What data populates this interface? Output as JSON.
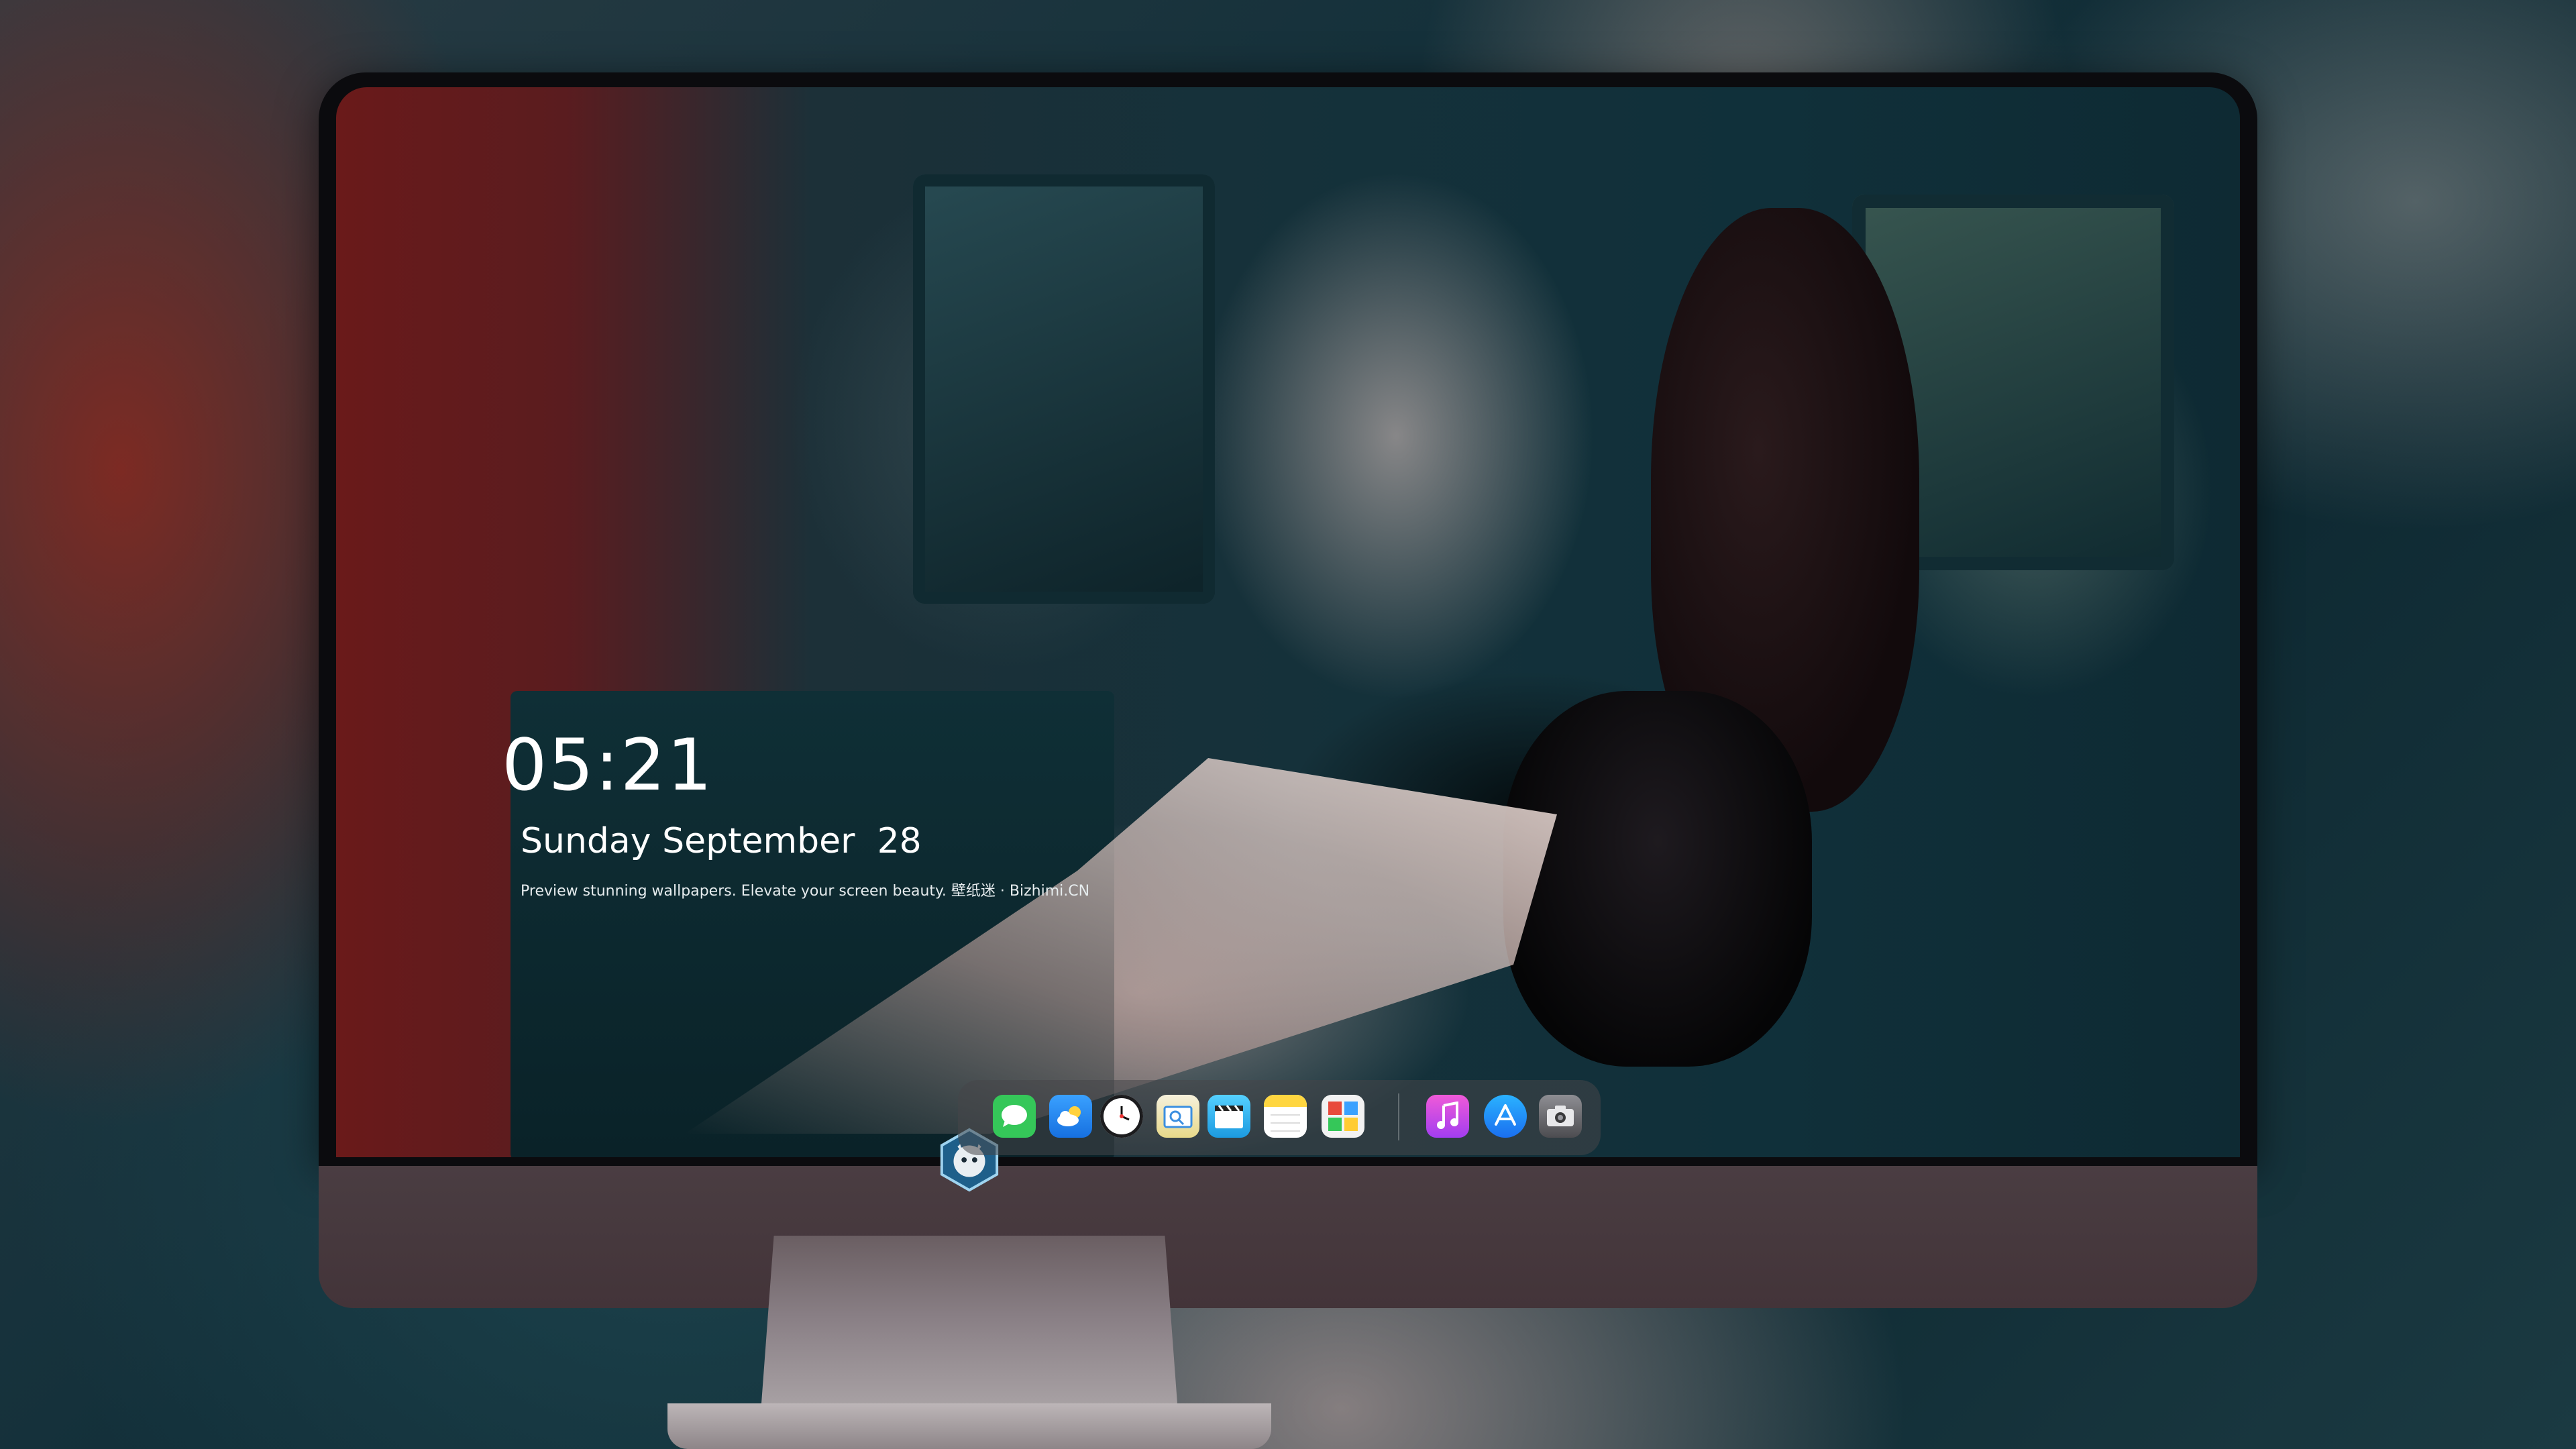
{
  "lock_screen": {
    "time": "05:21",
    "date": "Sunday September  28",
    "tagline": "Preview stunning wallpapers. Elevate your screen beauty. 壁纸迷 · Bizhimi.CN"
  },
  "dock": {
    "apps": [
      {
        "name": "Messages",
        "icon": "messages-icon",
        "color": "#35c759"
      },
      {
        "name": "Weather",
        "icon": "weather-icon",
        "color": "#1e8ef5"
      },
      {
        "name": "Clock",
        "icon": "clock-icon",
        "color": "#1c1c1e"
      },
      {
        "name": "Preview",
        "icon": "preview-icon",
        "color": "#f5c542"
      },
      {
        "name": "Clips",
        "icon": "clips-icon",
        "color": "#2fb6f0"
      },
      {
        "name": "Notes",
        "icon": "notes-icon",
        "color": "#ffd640"
      },
      {
        "name": "Photo Booth",
        "icon": "photo-booth-icon",
        "color": "#d63a3a"
      },
      {
        "name": "iTunes",
        "icon": "music-icon",
        "color": "#c64be8"
      },
      {
        "name": "App Store",
        "icon": "app-store-icon",
        "color": "#1a8cff"
      },
      {
        "name": "Screenshot",
        "icon": "camera-icon",
        "color": "#6b6b70"
      }
    ]
  },
  "colors": {
    "bezel": "#0b0b0e",
    "chin": "#4a3d42",
    "text": "#ffffff"
  }
}
